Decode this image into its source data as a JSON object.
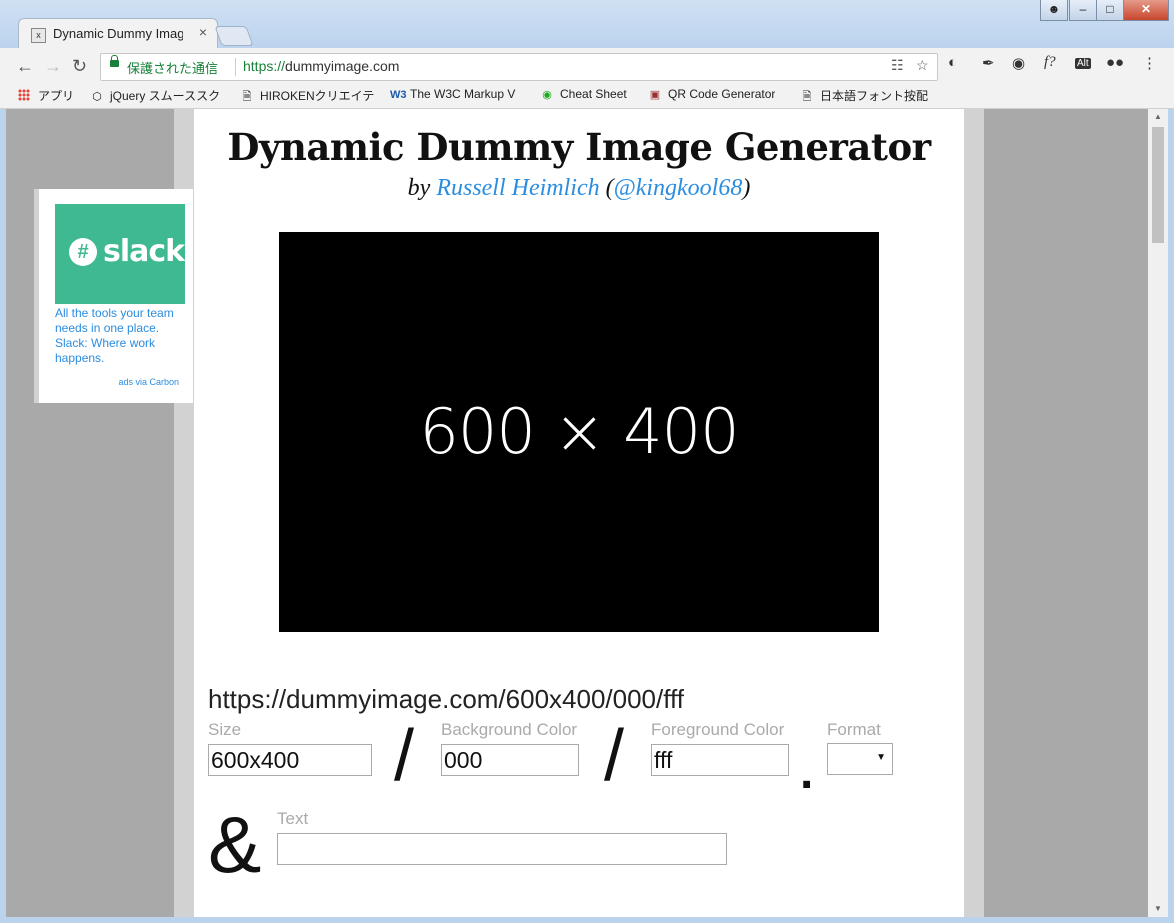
{
  "browser": {
    "tab_title": "Dynamic Dummy Image Generator",
    "tab_favicon": "x",
    "tab_close": "×",
    "secure_label": "保護された通信",
    "url_scheme": "https://",
    "url_host": "dummyimage.com"
  },
  "bookmarks": [
    {
      "label": "アプリ",
      "icon": "apps-grid-icon"
    },
    {
      "label": "jQuery スムーススク",
      "icon": "codepen-icon"
    },
    {
      "label": "HIROKENクリエイテ",
      "icon": "page-icon"
    },
    {
      "label": "The W3C Markup V",
      "icon": "w3c-icon"
    },
    {
      "label": "Cheat Sheet",
      "icon": "cheat-sheet-icon"
    },
    {
      "label": "QR Code Generator",
      "icon": "qr-icon"
    },
    {
      "label": "日本語フォント按配",
      "icon": "page-icon"
    }
  ],
  "page": {
    "title": "Dynamic Dummy Image Generator",
    "by": "by",
    "author": "Russell Heimlich",
    "handle": "@kingkool68",
    "paren_open": "(",
    "paren_close": ")",
    "preview_text": "600 × 400",
    "generated_url": "https://dummyimage.com/600x400/000/fff"
  },
  "ad": {
    "brand": "slack",
    "text": "All the tools your team needs in one place. Slack: Where work happens.",
    "via": "ads via Carbon"
  },
  "form": {
    "size_label": "Size",
    "size_value": "600x400",
    "bg_label": "Background Color",
    "bg_value": "000",
    "fg_label": "Foreground Color",
    "fg_value": "fff",
    "format_label": "Format",
    "format_value": "",
    "text_label": "Text",
    "text_value": "",
    "slash": "/",
    "dot": ".",
    "amp": "&"
  },
  "colors": {
    "link": "#2a8de0",
    "secure": "#188038",
    "slack_green": "#3eb991",
    "background_gray": "#a9a9a9"
  }
}
